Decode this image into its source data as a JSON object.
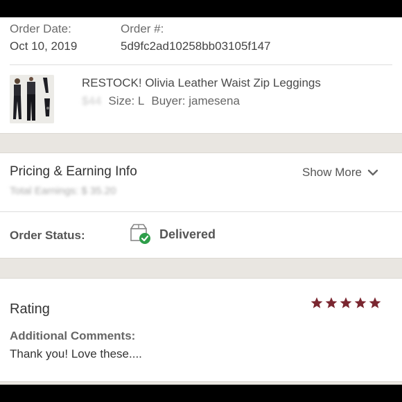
{
  "order": {
    "date_label": "Order Date:",
    "date_value": "Oct 10, 2019",
    "number_label": "Order #:",
    "number_value": "5d9fc2ad10258bb03105f147"
  },
  "item": {
    "title": "RESTOCK! Olivia Leather Waist Zip Leggings",
    "price_obscured": "$44",
    "size_text": "Size: L",
    "buyer_text": "Buyer: jamesena",
    "thumbnail_icon": "leggings-photo"
  },
  "pricing": {
    "title": "Pricing & Earning Info",
    "show_more_label": "Show More",
    "show_more_icon": "chevron-down-icon",
    "earnings_obscured": "Total Earnings: $ 35.20"
  },
  "status": {
    "label": "Order Status:",
    "value": "Delivered",
    "icon": "package-delivered-icon",
    "check_color": "#2e9e4a"
  },
  "rating": {
    "title": "Rating",
    "stars": 5,
    "star_color": "#7a2630",
    "comments_label": "Additional Comments:",
    "comments_text": "Thank you! Love these...."
  }
}
